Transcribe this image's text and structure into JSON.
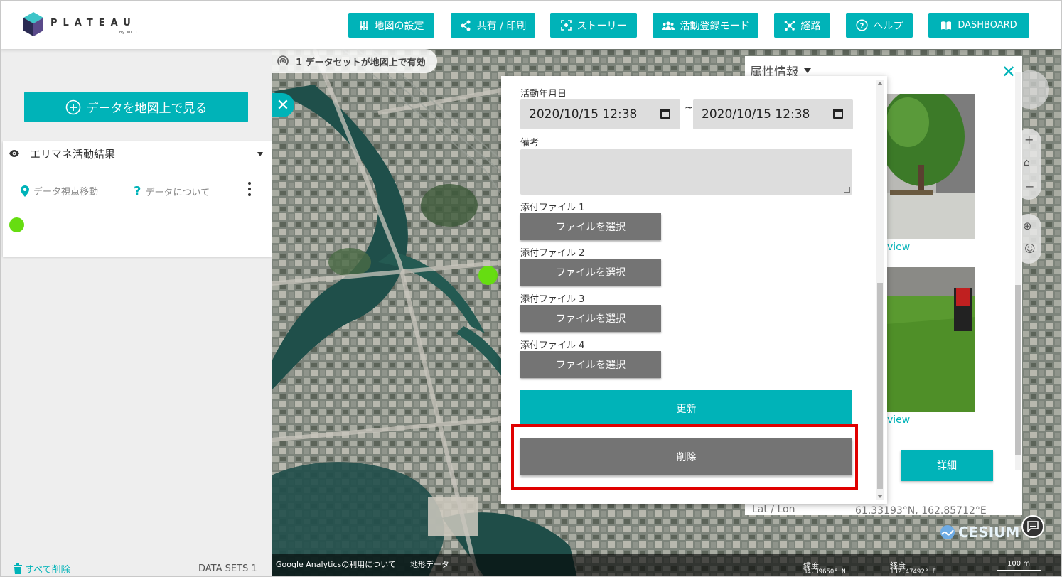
{
  "app": {
    "logo_text": "PLATEAU",
    "logo_sub": "by MLIT"
  },
  "nav": [
    {
      "label": "地図の設定",
      "icon": "sliders-icon"
    },
    {
      "label": "共有 / 印刷",
      "icon": "share-icon"
    },
    {
      "label": "ストーリー",
      "icon": "story-icon"
    },
    {
      "label": "活動登録モード",
      "icon": "people-icon"
    },
    {
      "label": "経路",
      "icon": "route-icon"
    },
    {
      "label": "ヘルプ",
      "icon": "help-icon"
    },
    {
      "label": "DASHBOARD",
      "icon": "book-icon"
    }
  ],
  "sidebar": {
    "view_button": "データを地図上で見る",
    "layer": {
      "title": "エリマネ活動結果",
      "move_view": "データ視点移動",
      "about": "データについて"
    },
    "remove_all": "すべて削除",
    "datasets": "DATA SETS 1"
  },
  "map": {
    "active_pill": "1 データセットが地図上で有効",
    "footer": {
      "analytics_link": "Google Analyticsの利用について",
      "terrain_link": "地形データ",
      "lat_label": "緯度",
      "lat_value": "34.39650° N",
      "lon_label": "経度",
      "lon_value": "132.47492° E",
      "scale": "100 m"
    },
    "credit": "CESIUM"
  },
  "attributes": {
    "title": "属性情報",
    "review_label": "view",
    "detail_button": "詳細",
    "latlon_label": "Lat / Lon",
    "latlon_value": "61.33193°N, 162.85712°E"
  },
  "form": {
    "date_label": "活動年月日",
    "date_from": "2020/10/15 12:38",
    "date_to": "2020/10/15 12:38",
    "tilde": "~",
    "note_label": "備考",
    "note_value": "",
    "files": [
      {
        "label": "添付ファイル 1",
        "button": "ファイルを選択"
      },
      {
        "label": "添付ファイル 2",
        "button": "ファイルを選択"
      },
      {
        "label": "添付ファイル 3",
        "button": "ファイルを選択"
      },
      {
        "label": "添付ファイル 4",
        "button": "ファイルを選択"
      }
    ],
    "update_button": "更新",
    "delete_button": "削除"
  },
  "colors": {
    "accent": "#00b3b8",
    "marker": "#66dd11",
    "highlight": "#e00000",
    "gray_button": "#747474"
  }
}
